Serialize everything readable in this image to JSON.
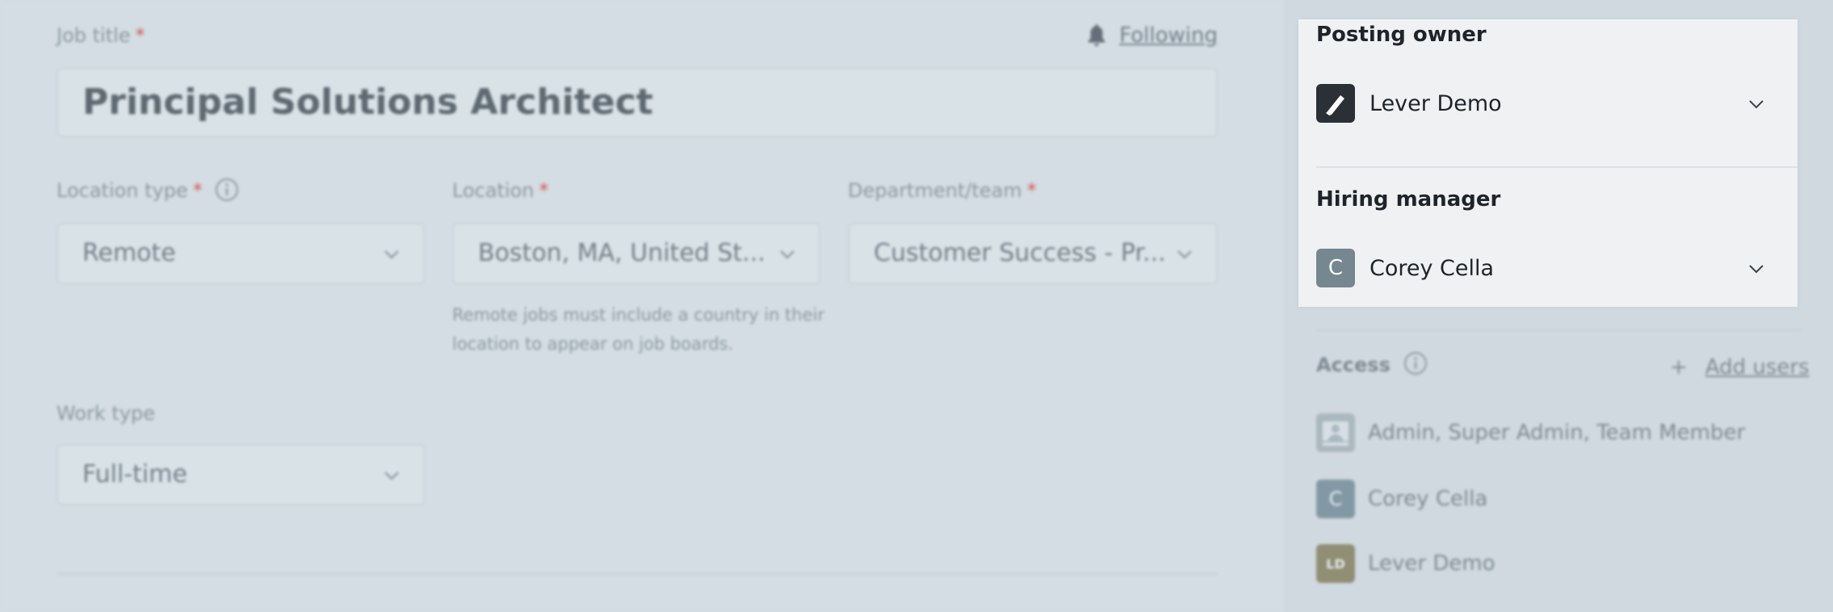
{
  "form": {
    "job_title_label": "Job title",
    "required_mark": "*",
    "job_title_value": "Principal Solutions Architect",
    "following_label": "Following",
    "location_type_label": "Location type",
    "location_type_value": "Remote",
    "location_label": "Location",
    "location_value": "Boston, MA, United St...",
    "location_hint": "Remote jobs must include a country in their location to appear on job boards.",
    "department_label": "Department/team",
    "department_value": "Customer Success - Pr...",
    "work_type_label": "Work type",
    "work_type_value": "Full-time"
  },
  "sidebar": {
    "posting_owner_title": "Posting owner",
    "posting_owner_name": "Lever Demo",
    "hiring_manager_title": "Hiring manager",
    "hiring_manager_initial": "C",
    "hiring_manager_name": "Corey Cella",
    "access_title": "Access",
    "add_users_plus": "+",
    "add_users_label": "Add users",
    "access_items": [
      {
        "initials": "",
        "name": "Admin, Super Admin, Team Member"
      },
      {
        "initials": "C",
        "name": "Corey Cella"
      },
      {
        "initials": "LD",
        "name": "Lever Demo"
      }
    ]
  },
  "colors": {
    "background": "#d3dde3",
    "card": "#eff1f3",
    "required": "#d9534f"
  }
}
